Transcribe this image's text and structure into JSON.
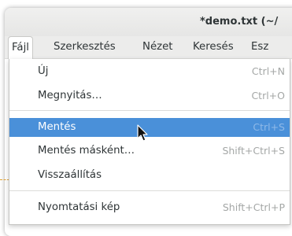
{
  "window": {
    "title": "*demo.txt (~/"
  },
  "menubar": {
    "items": [
      "Fájl",
      "Szerkesztés",
      "Nézet",
      "Keresés",
      "Esz"
    ]
  },
  "file_menu": {
    "items": [
      {
        "label": "Új",
        "shortcut": "Ctrl+N"
      },
      {
        "label": "Megnyitás…",
        "shortcut": "Ctrl+O"
      },
      {
        "label": "Mentés",
        "shortcut": "Ctrl+S",
        "selected": true
      },
      {
        "label": "Mentés másként…",
        "shortcut": "Shift+Ctrl+S"
      },
      {
        "label": "Visszaállítás",
        "shortcut": ""
      },
      {
        "label": "Nyomtatási kép",
        "shortcut": "Shift+Ctrl+P"
      }
    ]
  },
  "colors": {
    "selection": "#4a90d9",
    "text": "#2e3436",
    "shortcut": "#a4a7a6"
  },
  "icons": {
    "cursor": "mouse-pointer-icon"
  }
}
